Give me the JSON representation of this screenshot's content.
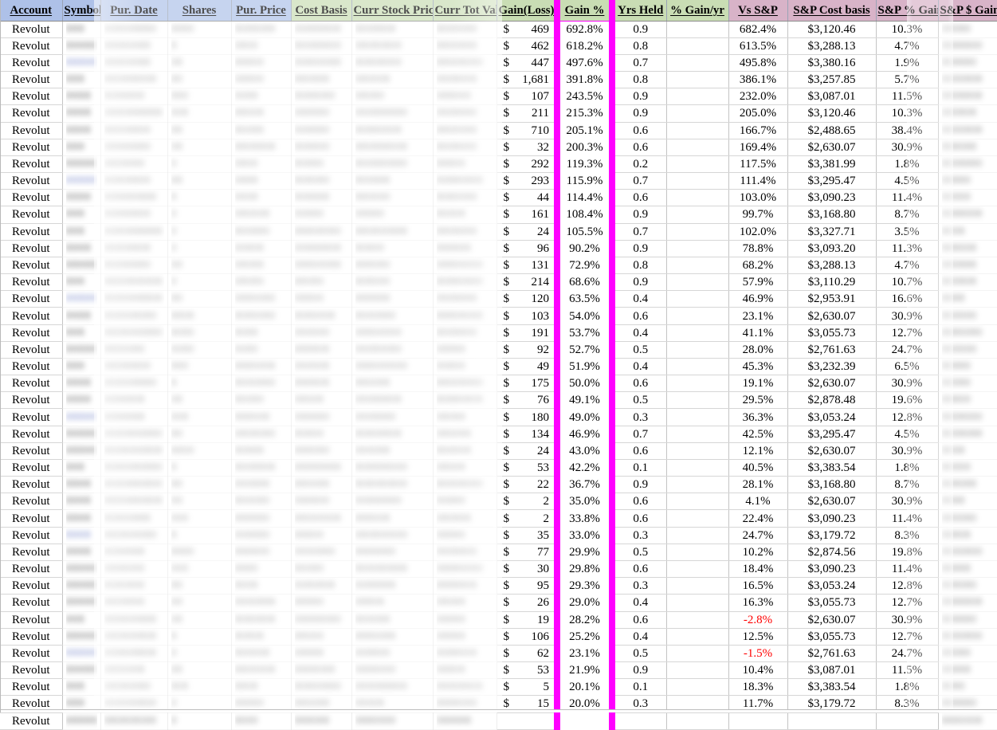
{
  "app": {
    "kind": "spreadsheet",
    "sheet_name": "Portfolio Holdings"
  },
  "colors": {
    "header_blue": "#aec1e8",
    "header_green": "#c9ddb4",
    "header_pink": "#d8b3c8",
    "highlight_magenta": "#ff00ff",
    "negative_red": "#ff0000",
    "grid_line": "#c4c4c4"
  },
  "columns": [
    {
      "key": "account",
      "label": "Account",
      "group": "blue",
      "align": "center",
      "redacted": false
    },
    {
      "key": "symbol",
      "label": "Symbol",
      "group": "blue",
      "align": "center",
      "redacted": true
    },
    {
      "key": "pur_date",
      "label": "Pur. Date",
      "group": "blue",
      "align": "center",
      "redacted": true
    },
    {
      "key": "shares",
      "label": "Shares",
      "group": "blue",
      "align": "center",
      "redacted": true
    },
    {
      "key": "pur_price",
      "label": "Pur. Price",
      "group": "blue",
      "align": "center",
      "redacted": true
    },
    {
      "key": "cost_basis",
      "label": "Cost Basis",
      "group": "green",
      "align": "center",
      "redacted": true
    },
    {
      "key": "curr_stock",
      "label": "Curr Stock Price",
      "group": "green",
      "align": "center",
      "redacted": true
    },
    {
      "key": "curr_tot_value",
      "label": "Curr Tot Value",
      "group": "green",
      "align": "center",
      "redacted": true
    },
    {
      "key": "gain_loss",
      "label": "Gain(Loss)",
      "group": "green",
      "align": "right",
      "redacted": false
    },
    {
      "key": "gain_pct",
      "label": "Gain %",
      "group": "green",
      "align": "center",
      "redacted": false,
      "highlighted": true
    },
    {
      "key": "yrs_held",
      "label": "Yrs Held",
      "group": "green",
      "align": "center",
      "redacted": false
    },
    {
      "key": "pct_gain_yr",
      "label": "% Gain/yr",
      "group": "green",
      "align": "center",
      "redacted": false
    },
    {
      "key": "vs_sp",
      "label": "Vs S&P",
      "group": "pink",
      "align": "center",
      "redacted": false
    },
    {
      "key": "sp_cost_basis",
      "label": "S&P Cost basis",
      "group": "pink",
      "align": "center",
      "redacted": false
    },
    {
      "key": "sp_pct_gain",
      "label": "S&P % Gain",
      "group": "pink",
      "align": "center",
      "redacted": false
    },
    {
      "key": "sp_dollar_gain",
      "label": "S&P $ Gain(Loss)",
      "group": "pink",
      "align": "center",
      "redacted": true
    }
  ],
  "rows": [
    {
      "account": "Revolut",
      "gain_loss": "469",
      "gain_pct": "692.8%",
      "yrs_held": "0.9",
      "pct_gain_yr": "",
      "vs_sp": "682.4%",
      "vs_sp_negative": false,
      "sp_cost_basis": "$3,120.46",
      "sp_pct_gain": "10.3%"
    },
    {
      "account": "Revolut",
      "gain_loss": "462",
      "gain_pct": "618.2%",
      "yrs_held": "0.8",
      "pct_gain_yr": "",
      "vs_sp": "613.5%",
      "vs_sp_negative": false,
      "sp_cost_basis": "$3,288.13",
      "sp_pct_gain": "4.7%"
    },
    {
      "account": "Revolut",
      "gain_loss": "447",
      "gain_pct": "497.6%",
      "yrs_held": "0.7",
      "pct_gain_yr": "",
      "vs_sp": "495.8%",
      "vs_sp_negative": false,
      "sp_cost_basis": "$3,380.16",
      "sp_pct_gain": "1.9%"
    },
    {
      "account": "Revolut",
      "gain_loss": "1,681",
      "gain_pct": "391.8%",
      "yrs_held": "0.8",
      "pct_gain_yr": "",
      "vs_sp": "386.1%",
      "vs_sp_negative": false,
      "sp_cost_basis": "$3,257.85",
      "sp_pct_gain": "5.7%"
    },
    {
      "account": "Revolut",
      "gain_loss": "107",
      "gain_pct": "243.5%",
      "yrs_held": "0.9",
      "pct_gain_yr": "",
      "vs_sp": "232.0%",
      "vs_sp_negative": false,
      "sp_cost_basis": "$3,087.01",
      "sp_pct_gain": "11.5%"
    },
    {
      "account": "Revolut",
      "gain_loss": "211",
      "gain_pct": "215.3%",
      "yrs_held": "0.9",
      "pct_gain_yr": "",
      "vs_sp": "205.0%",
      "vs_sp_negative": false,
      "sp_cost_basis": "$3,120.46",
      "sp_pct_gain": "10.3%"
    },
    {
      "account": "Revolut",
      "gain_loss": "710",
      "gain_pct": "205.1%",
      "yrs_held": "0.6",
      "pct_gain_yr": "",
      "vs_sp": "166.7%",
      "vs_sp_negative": false,
      "sp_cost_basis": "$2,488.65",
      "sp_pct_gain": "38.4%"
    },
    {
      "account": "Revolut",
      "gain_loss": "32",
      "gain_pct": "200.3%",
      "yrs_held": "0.6",
      "pct_gain_yr": "",
      "vs_sp": "169.4%",
      "vs_sp_negative": false,
      "sp_cost_basis": "$2,630.07",
      "sp_pct_gain": "30.9%"
    },
    {
      "account": "Revolut",
      "gain_loss": "292",
      "gain_pct": "119.3%",
      "yrs_held": "0.2",
      "pct_gain_yr": "",
      "vs_sp": "117.5%",
      "vs_sp_negative": false,
      "sp_cost_basis": "$3,381.99",
      "sp_pct_gain": "1.8%"
    },
    {
      "account": "Revolut",
      "gain_loss": "293",
      "gain_pct": "115.9%",
      "yrs_held": "0.7",
      "pct_gain_yr": "",
      "vs_sp": "111.4%",
      "vs_sp_negative": false,
      "sp_cost_basis": "$3,295.47",
      "sp_pct_gain": "4.5%"
    },
    {
      "account": "Revolut",
      "gain_loss": "44",
      "gain_pct": "114.4%",
      "yrs_held": "0.6",
      "pct_gain_yr": "",
      "vs_sp": "103.0%",
      "vs_sp_negative": false,
      "sp_cost_basis": "$3,090.23",
      "sp_pct_gain": "11.4%"
    },
    {
      "account": "Revolut",
      "gain_loss": "161",
      "gain_pct": "108.4%",
      "yrs_held": "0.9",
      "pct_gain_yr": "",
      "vs_sp": "99.7%",
      "vs_sp_negative": false,
      "sp_cost_basis": "$3,168.80",
      "sp_pct_gain": "8.7%"
    },
    {
      "account": "Revolut",
      "gain_loss": "24",
      "gain_pct": "105.5%",
      "yrs_held": "0.7",
      "pct_gain_yr": "",
      "vs_sp": "102.0%",
      "vs_sp_negative": false,
      "sp_cost_basis": "$3,327.71",
      "sp_pct_gain": "3.5%"
    },
    {
      "account": "Revolut",
      "gain_loss": "96",
      "gain_pct": "90.2%",
      "yrs_held": "0.9",
      "pct_gain_yr": "",
      "vs_sp": "78.8%",
      "vs_sp_negative": false,
      "sp_cost_basis": "$3,093.20",
      "sp_pct_gain": "11.3%"
    },
    {
      "account": "Revolut",
      "gain_loss": "131",
      "gain_pct": "72.9%",
      "yrs_held": "0.8",
      "pct_gain_yr": "",
      "vs_sp": "68.2%",
      "vs_sp_negative": false,
      "sp_cost_basis": "$3,288.13",
      "sp_pct_gain": "4.7%"
    },
    {
      "account": "Revolut",
      "gain_loss": "214",
      "gain_pct": "68.6%",
      "yrs_held": "0.9",
      "pct_gain_yr": "",
      "vs_sp": "57.9%",
      "vs_sp_negative": false,
      "sp_cost_basis": "$3,110.29",
      "sp_pct_gain": "10.7%"
    },
    {
      "account": "Revolut",
      "gain_loss": "120",
      "gain_pct": "63.5%",
      "yrs_held": "0.4",
      "pct_gain_yr": "",
      "vs_sp": "46.9%",
      "vs_sp_negative": false,
      "sp_cost_basis": "$2,953.91",
      "sp_pct_gain": "16.6%"
    },
    {
      "account": "Revolut",
      "gain_loss": "103",
      "gain_pct": "54.0%",
      "yrs_held": "0.6",
      "pct_gain_yr": "",
      "vs_sp": "23.1%",
      "vs_sp_negative": false,
      "sp_cost_basis": "$2,630.07",
      "sp_pct_gain": "30.9%"
    },
    {
      "account": "Revolut",
      "gain_loss": "191",
      "gain_pct": "53.7%",
      "yrs_held": "0.4",
      "pct_gain_yr": "",
      "vs_sp": "41.1%",
      "vs_sp_negative": false,
      "sp_cost_basis": "$3,055.73",
      "sp_pct_gain": "12.7%"
    },
    {
      "account": "Revolut",
      "gain_loss": "92",
      "gain_pct": "52.7%",
      "yrs_held": "0.5",
      "pct_gain_yr": "",
      "vs_sp": "28.0%",
      "vs_sp_negative": false,
      "sp_cost_basis": "$2,761.63",
      "sp_pct_gain": "24.7%"
    },
    {
      "account": "Revolut",
      "gain_loss": "49",
      "gain_pct": "51.9%",
      "yrs_held": "0.4",
      "pct_gain_yr": "",
      "vs_sp": "45.3%",
      "vs_sp_negative": false,
      "sp_cost_basis": "$3,232.39",
      "sp_pct_gain": "6.5%"
    },
    {
      "account": "Revolut",
      "gain_loss": "175",
      "gain_pct": "50.0%",
      "yrs_held": "0.6",
      "pct_gain_yr": "",
      "vs_sp": "19.1%",
      "vs_sp_negative": false,
      "sp_cost_basis": "$2,630.07",
      "sp_pct_gain": "30.9%"
    },
    {
      "account": "Revolut",
      "gain_loss": "76",
      "gain_pct": "49.1%",
      "yrs_held": "0.5",
      "pct_gain_yr": "",
      "vs_sp": "29.5%",
      "vs_sp_negative": false,
      "sp_cost_basis": "$2,878.48",
      "sp_pct_gain": "19.6%"
    },
    {
      "account": "Revolut",
      "gain_loss": "180",
      "gain_pct": "49.0%",
      "yrs_held": "0.3",
      "pct_gain_yr": "",
      "vs_sp": "36.3%",
      "vs_sp_negative": false,
      "sp_cost_basis": "$3,053.24",
      "sp_pct_gain": "12.8%"
    },
    {
      "account": "Revolut",
      "gain_loss": "134",
      "gain_pct": "46.9%",
      "yrs_held": "0.7",
      "pct_gain_yr": "",
      "vs_sp": "42.5%",
      "vs_sp_negative": false,
      "sp_cost_basis": "$3,295.47",
      "sp_pct_gain": "4.5%"
    },
    {
      "account": "Revolut",
      "gain_loss": "24",
      "gain_pct": "43.0%",
      "yrs_held": "0.6",
      "pct_gain_yr": "",
      "vs_sp": "12.1%",
      "vs_sp_negative": false,
      "sp_cost_basis": "$2,630.07",
      "sp_pct_gain": "30.9%"
    },
    {
      "account": "Revolut",
      "gain_loss": "53",
      "gain_pct": "42.2%",
      "yrs_held": "0.1",
      "pct_gain_yr": "",
      "vs_sp": "40.5%",
      "vs_sp_negative": false,
      "sp_cost_basis": "$3,383.54",
      "sp_pct_gain": "1.8%"
    },
    {
      "account": "Revolut",
      "gain_loss": "22",
      "gain_pct": "36.7%",
      "yrs_held": "0.9",
      "pct_gain_yr": "",
      "vs_sp": "28.1%",
      "vs_sp_negative": false,
      "sp_cost_basis": "$3,168.80",
      "sp_pct_gain": "8.7%"
    },
    {
      "account": "Revolut",
      "gain_loss": "2",
      "gain_pct": "35.0%",
      "yrs_held": "0.6",
      "pct_gain_yr": "",
      "vs_sp": "4.1%",
      "vs_sp_negative": false,
      "sp_cost_basis": "$2,630.07",
      "sp_pct_gain": "30.9%"
    },
    {
      "account": "Revolut",
      "gain_loss": "2",
      "gain_pct": "33.8%",
      "yrs_held": "0.6",
      "pct_gain_yr": "",
      "vs_sp": "22.4%",
      "vs_sp_negative": false,
      "sp_cost_basis": "$3,090.23",
      "sp_pct_gain": "11.4%"
    },
    {
      "account": "Revolut",
      "gain_loss": "35",
      "gain_pct": "33.0%",
      "yrs_held": "0.3",
      "pct_gain_yr": "",
      "vs_sp": "24.7%",
      "vs_sp_negative": false,
      "sp_cost_basis": "$3,179.72",
      "sp_pct_gain": "8.3%"
    },
    {
      "account": "Revolut",
      "gain_loss": "77",
      "gain_pct": "29.9%",
      "yrs_held": "0.5",
      "pct_gain_yr": "",
      "vs_sp": "10.2%",
      "vs_sp_negative": false,
      "sp_cost_basis": "$2,874.56",
      "sp_pct_gain": "19.8%"
    },
    {
      "account": "Revolut",
      "gain_loss": "30",
      "gain_pct": "29.8%",
      "yrs_held": "0.6",
      "pct_gain_yr": "",
      "vs_sp": "18.4%",
      "vs_sp_negative": false,
      "sp_cost_basis": "$3,090.23",
      "sp_pct_gain": "11.4%"
    },
    {
      "account": "Revolut",
      "gain_loss": "95",
      "gain_pct": "29.3%",
      "yrs_held": "0.3",
      "pct_gain_yr": "",
      "vs_sp": "16.5%",
      "vs_sp_negative": false,
      "sp_cost_basis": "$3,053.24",
      "sp_pct_gain": "12.8%"
    },
    {
      "account": "Revolut",
      "gain_loss": "26",
      "gain_pct": "29.0%",
      "yrs_held": "0.4",
      "pct_gain_yr": "",
      "vs_sp": "16.3%",
      "vs_sp_negative": false,
      "sp_cost_basis": "$3,055.73",
      "sp_pct_gain": "12.7%"
    },
    {
      "account": "Revolut",
      "gain_loss": "19",
      "gain_pct": "28.2%",
      "yrs_held": "0.6",
      "pct_gain_yr": "",
      "vs_sp": "-2.8%",
      "vs_sp_negative": true,
      "sp_cost_basis": "$2,630.07",
      "sp_pct_gain": "30.9%"
    },
    {
      "account": "Revolut",
      "gain_loss": "106",
      "gain_pct": "25.2%",
      "yrs_held": "0.4",
      "pct_gain_yr": "",
      "vs_sp": "12.5%",
      "vs_sp_negative": false,
      "sp_cost_basis": "$3,055.73",
      "sp_pct_gain": "12.7%"
    },
    {
      "account": "Revolut",
      "gain_loss": "62",
      "gain_pct": "23.1%",
      "yrs_held": "0.5",
      "pct_gain_yr": "",
      "vs_sp": "-1.5%",
      "vs_sp_negative": true,
      "sp_cost_basis": "$2,761.63",
      "sp_pct_gain": "24.7%"
    },
    {
      "account": "Revolut",
      "gain_loss": "53",
      "gain_pct": "21.9%",
      "yrs_held": "0.9",
      "pct_gain_yr": "",
      "vs_sp": "10.4%",
      "vs_sp_negative": false,
      "sp_cost_basis": "$3,087.01",
      "sp_pct_gain": "11.5%"
    },
    {
      "account": "Revolut",
      "gain_loss": "5",
      "gain_pct": "20.1%",
      "yrs_held": "0.1",
      "pct_gain_yr": "",
      "vs_sp": "18.3%",
      "vs_sp_negative": false,
      "sp_cost_basis": "$3,383.54",
      "sp_pct_gain": "1.8%"
    },
    {
      "account": "Revolut",
      "gain_loss": "15",
      "gain_pct": "20.0%",
      "yrs_held": "0.3",
      "pct_gain_yr": "",
      "vs_sp": "11.7%",
      "vs_sp_negative": false,
      "sp_cost_basis": "$3,179.72",
      "sp_pct_gain": "8.3%"
    },
    {
      "account": "Revolut",
      "gain_loss": "",
      "gain_pct": "",
      "yrs_held": "",
      "pct_gain_yr": "",
      "vs_sp": "",
      "vs_sp_negative": false,
      "sp_cost_basis": "",
      "sp_pct_gain": ""
    }
  ],
  "currency_symbol": "$",
  "redacted_placeholder": "████"
}
